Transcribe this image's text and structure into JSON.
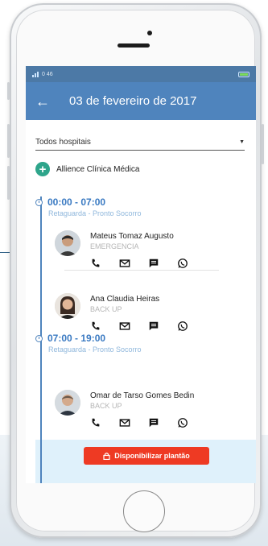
{
  "status_bar": {
    "carrier": "0 46"
  },
  "header": {
    "title": "03 de fevereiro de 2017",
    "back_icon": "arrow-left-icon"
  },
  "filter": {
    "selected": "Todos hospitais"
  },
  "hospital": {
    "name": "Allience Clínica Médica",
    "icon": "plus-circle-icon"
  },
  "shifts": [
    {
      "time": "00:00 - 07:00",
      "subtitle": "Retaguarda - Pronto Socorro",
      "people": [
        {
          "name": "Mateus Tomaz Augusto",
          "role": "EMERGENCIA"
        },
        {
          "name": "Ana Claudia Heiras",
          "role": "BACK UP"
        }
      ]
    },
    {
      "time": "07:00 - 19:00",
      "subtitle": "Retaguarda - Pronto Socorro",
      "people": [
        {
          "name": "Omar de Tarso Gomes Bedin",
          "role": "BACK UP"
        }
      ]
    }
  ],
  "cta": {
    "label": "Disponibilizar plantão"
  },
  "colors": {
    "appbar": "#4f84bd",
    "accent_red": "#ee3a23",
    "highlight": "#dff1fb",
    "hospital_icon": "#2ea58b"
  }
}
